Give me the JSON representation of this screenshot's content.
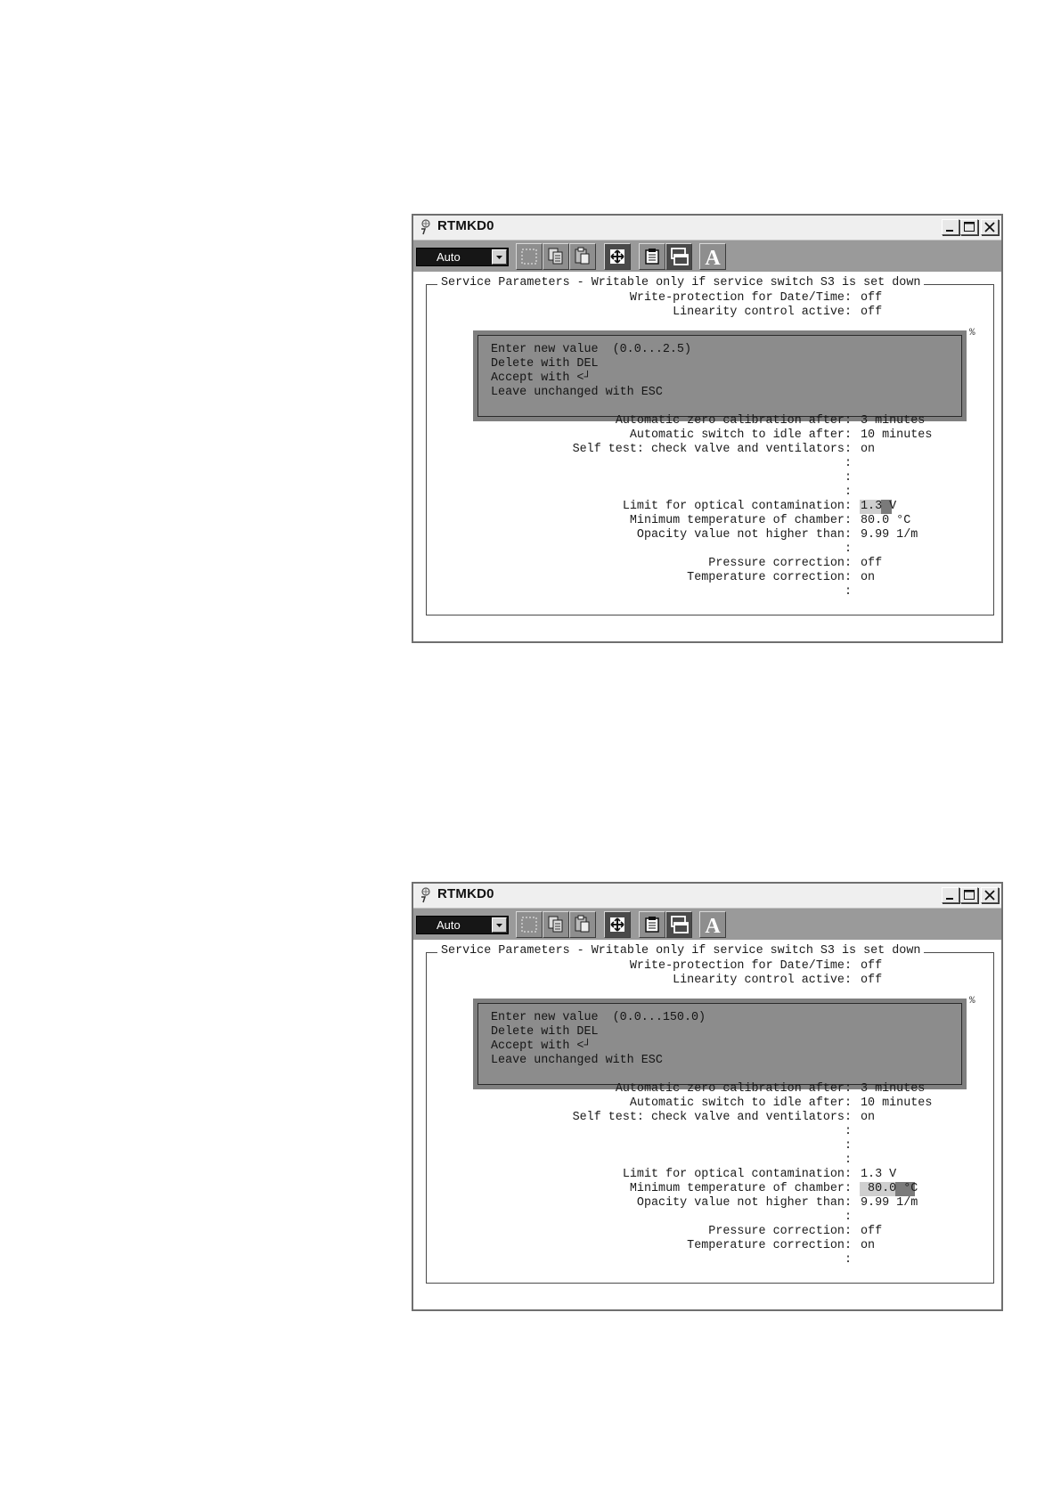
{
  "windows": [
    {
      "title": "RTMKD0",
      "toolbar": {
        "mode_value": "Auto"
      },
      "frame_title": "Service Parameters - Writable only if service switch S3 is set down",
      "top_params": [
        {
          "label": "Write-protection for Date/Time:",
          "value": "off"
        },
        {
          "label": "Linearity control active:",
          "value": "off"
        }
      ],
      "dialog": {
        "lines": [
          "Enter new value  (0.0...2.5)",
          "Delete with DEL",
          "Accept with <┘",
          "Leave unchanged with ESC"
        ]
      },
      "params": [
        {
          "label": "Automatic zero calibration after:",
          "value": "3 minutes"
        },
        {
          "label": "Automatic switch to idle after:",
          "value": "10 minutes"
        },
        {
          "label": "Self test: check valve and ventilators:",
          "value": "on"
        },
        {
          "label": ":",
          "value": ""
        },
        {
          "label": ":",
          "value": ""
        },
        {
          "label": ":",
          "value": ""
        },
        {
          "label": "Limit for optical contamination:",
          "value": "1.3 V"
        },
        {
          "label": "Minimum temperature of chamber:",
          "value": "80.0 °C"
        },
        {
          "label": "Opacity value not higher than:",
          "value": "9.99 1/m"
        },
        {
          "label": ":",
          "value": ""
        },
        {
          "label": "Pressure correction:",
          "value": "off"
        },
        {
          "label": "Temperature correction:",
          "value": "on"
        },
        {
          "label": ":",
          "value": ""
        }
      ],
      "editing_field": "Limit for optical contamination"
    },
    {
      "title": "RTMKD0",
      "toolbar": {
        "mode_value": "Auto"
      },
      "frame_title": "Service Parameters - Writable only if service switch S3 is set down",
      "top_params": [
        {
          "label": "Write-protection for Date/Time:",
          "value": "off"
        },
        {
          "label": "Linearity control active:",
          "value": "off"
        }
      ],
      "dialog": {
        "lines": [
          "Enter new value  (0.0...150.0)",
          "Delete with DEL",
          "Accept with <┘",
          "Leave unchanged with ESC"
        ]
      },
      "params": [
        {
          "label": "Automatic zero calibration after:",
          "value": "3 minutes"
        },
        {
          "label": "Automatic switch to idle after:",
          "value": "10 minutes"
        },
        {
          "label": "Self test: check valve and ventilators:",
          "value": "on"
        },
        {
          "label": ":",
          "value": ""
        },
        {
          "label": ":",
          "value": ""
        },
        {
          "label": ":",
          "value": ""
        },
        {
          "label": "Limit for optical contamination:",
          "value": "1.3 V"
        },
        {
          "label": "Minimum temperature of chamber:",
          "value": " 80.0 °C"
        },
        {
          "label": "Opacity value not higher than:",
          "value": "9.99 1/m"
        },
        {
          "label": ":",
          "value": ""
        },
        {
          "label": "Pressure correction:",
          "value": "off"
        },
        {
          "label": "Temperature correction:",
          "value": "on"
        },
        {
          "label": ":",
          "value": ""
        }
      ],
      "editing_field": "Minimum temperature of chamber"
    }
  ],
  "colors": {
    "toolbar": "#9a9a9a",
    "dialog": "#8c8c8c",
    "highlight_light": "#cfcfcf",
    "highlight_dark": "#7a7a7a"
  }
}
